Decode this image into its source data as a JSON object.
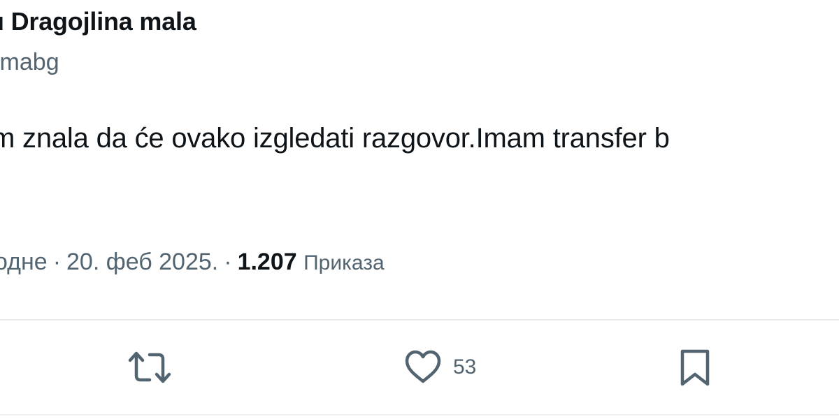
{
  "tweet": {
    "author_name": "u Dragojlina mala",
    "handle": "lmabg",
    "text": "m znala da će ovako izgledati razgovor.Imam transfer b",
    "time": "одне",
    "date": "20. феб 2025.",
    "separator": "·",
    "views_count": "1.207",
    "views_label": "Приказа"
  },
  "actions": {
    "retweet_icon": "retweet-icon",
    "like_icon": "heart-icon",
    "like_count": "53",
    "bookmark_icon": "bookmark-icon"
  },
  "colors": {
    "text_primary": "#0f1419",
    "text_secondary": "#536471",
    "divider": "#e8ecef"
  }
}
